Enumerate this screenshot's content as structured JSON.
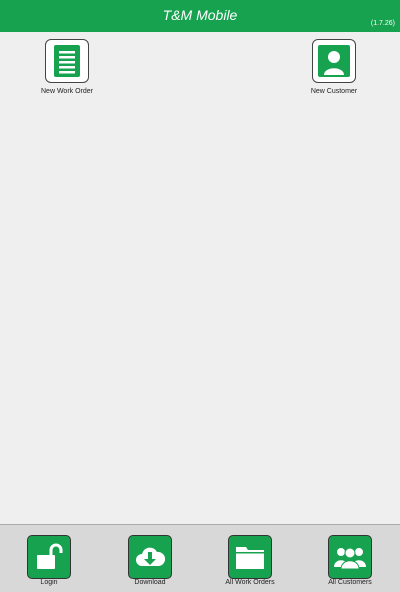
{
  "header": {
    "title": "T&M Mobile",
    "version": "(1.7.26)",
    "color": "#17a24f"
  },
  "home": {
    "tiles": [
      {
        "label": "New Work Order",
        "icon": "document-list-icon"
      },
      {
        "label": "New Customer",
        "icon": "person-icon"
      }
    ]
  },
  "bottom_nav": {
    "items": [
      {
        "label": "Login",
        "icon": "unlock-icon"
      },
      {
        "label": "Download",
        "icon": "cloud-download-icon"
      },
      {
        "label": "All Work Orders",
        "icon": "folder-icon"
      },
      {
        "label": "All Customers",
        "icon": "group-icon"
      }
    ]
  }
}
